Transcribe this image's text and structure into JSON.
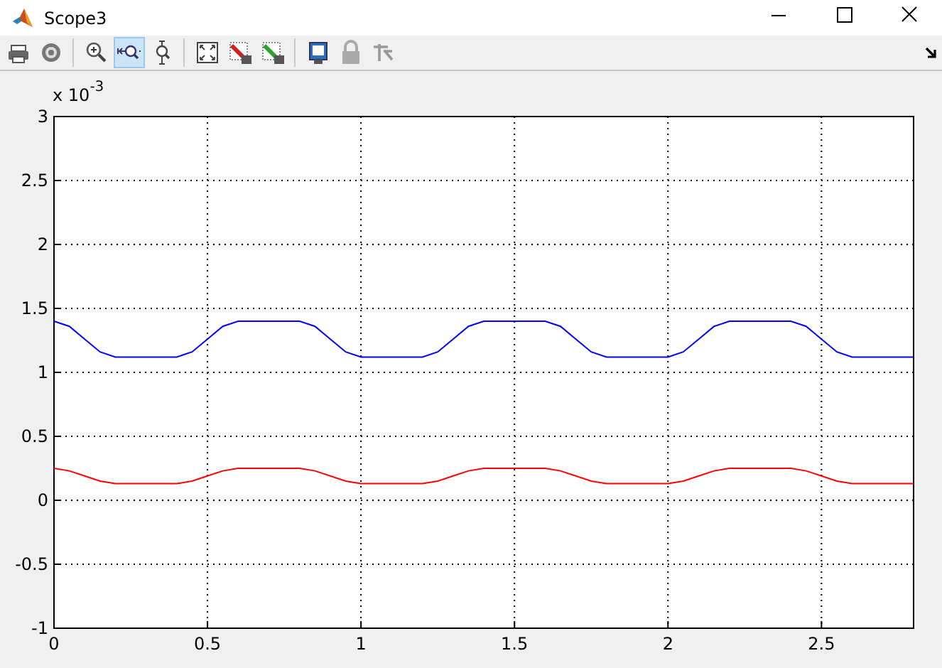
{
  "window": {
    "title": "Scope3"
  },
  "toolbar": {
    "tools": [
      {
        "kind": "print",
        "selected": false
      },
      {
        "kind": "settings",
        "selected": false
      },
      {
        "kind": "separator"
      },
      {
        "kind": "zoom",
        "selected": false
      },
      {
        "kind": "zoom-x",
        "selected": true
      },
      {
        "kind": "zoom-y",
        "selected": false
      },
      {
        "kind": "separator"
      },
      {
        "kind": "autoscale",
        "selected": false
      },
      {
        "kind": "save-axes",
        "selected": false
      },
      {
        "kind": "restore-axes",
        "selected": false
      },
      {
        "kind": "separator"
      },
      {
        "kind": "floating",
        "selected": false
      },
      {
        "kind": "lock",
        "selected": false
      },
      {
        "kind": "signal-select",
        "selected": false
      }
    ]
  },
  "plot": {
    "multiplier": "x 10$^{-3}$",
    "chart_data": {
      "type": "line",
      "x": [
        0,
        0.05,
        0.1,
        0.15,
        0.2,
        0.25,
        0.3,
        0.35,
        0.4,
        0.45,
        0.5,
        0.55,
        0.6,
        0.65,
        0.7,
        0.75,
        0.8,
        0.85,
        0.9,
        0.95,
        1,
        1.05,
        1.1,
        1.15,
        1.2,
        1.25,
        1.3,
        1.35,
        1.4,
        1.45,
        1.5,
        1.55,
        1.6,
        1.65,
        1.7,
        1.75,
        1.8,
        1.85,
        1.9,
        1.95,
        2,
        2.05,
        2.1,
        2.15,
        2.2,
        2.25,
        2.3,
        2.35,
        2.4,
        2.45,
        2.5,
        2.55,
        2.6,
        2.65,
        2.7,
        2.75,
        2.8
      ],
      "series": [
        {
          "color": "#0000ff",
          "values": [
            1.4,
            1.36,
            1.26,
            1.16,
            1.12,
            1.12,
            1.12,
            1.12,
            1.12,
            1.16,
            1.26,
            1.36,
            1.4,
            1.4,
            1.4,
            1.4,
            1.4,
            1.36,
            1.26,
            1.16,
            1.12,
            1.12,
            1.12,
            1.12,
            1.12,
            1.16,
            1.26,
            1.36,
            1.4,
            1.4,
            1.4,
            1.4,
            1.4,
            1.36,
            1.26,
            1.16,
            1.12,
            1.12,
            1.12,
            1.12,
            1.12,
            1.16,
            1.26,
            1.36,
            1.4,
            1.4,
            1.4,
            1.4,
            1.4,
            1.36,
            1.26,
            1.16,
            1.12,
            1.12,
            1.12,
            1.12,
            1.12
          ]
        },
        {
          "color": "#ff0000",
          "values": [
            0.25,
            0.23,
            0.19,
            0.15,
            0.13,
            0.13,
            0.13,
            0.13,
            0.13,
            0.15,
            0.19,
            0.23,
            0.25,
            0.25,
            0.25,
            0.25,
            0.25,
            0.23,
            0.19,
            0.15,
            0.13,
            0.13,
            0.13,
            0.13,
            0.13,
            0.15,
            0.19,
            0.23,
            0.25,
            0.25,
            0.25,
            0.25,
            0.25,
            0.23,
            0.19,
            0.15,
            0.13,
            0.13,
            0.13,
            0.13,
            0.13,
            0.15,
            0.19,
            0.23,
            0.25,
            0.25,
            0.25,
            0.25,
            0.25,
            0.23,
            0.19,
            0.15,
            0.13,
            0.13,
            0.13,
            0.13,
            0.13
          ]
        }
      ],
      "grid": true,
      "xlim": [
        0,
        2.8
      ],
      "ylim": [
        -1,
        3
      ],
      "xticks": [
        {
          "value": 0,
          "label": "0"
        },
        {
          "value": 0.5,
          "label": "0.5"
        },
        {
          "value": 1,
          "label": "1"
        },
        {
          "value": 1.5,
          "label": "1.5"
        },
        {
          "value": 2,
          "label": "2"
        },
        {
          "value": 2.5,
          "label": "2.5"
        }
      ],
      "yticks": [
        {
          "value": -1,
          "label": "-1"
        },
        {
          "value": -0.5,
          "label": "-0.5"
        },
        {
          "value": 0,
          "label": "0"
        },
        {
          "value": 0.5,
          "label": "0.5"
        },
        {
          "value": 1,
          "label": "1"
        },
        {
          "value": 1.5,
          "label": "1.5"
        },
        {
          "value": 2,
          "label": "2"
        },
        {
          "value": 2.5,
          "label": "2.5"
        },
        {
          "value": 3,
          "label": "3"
        }
      ]
    }
  }
}
